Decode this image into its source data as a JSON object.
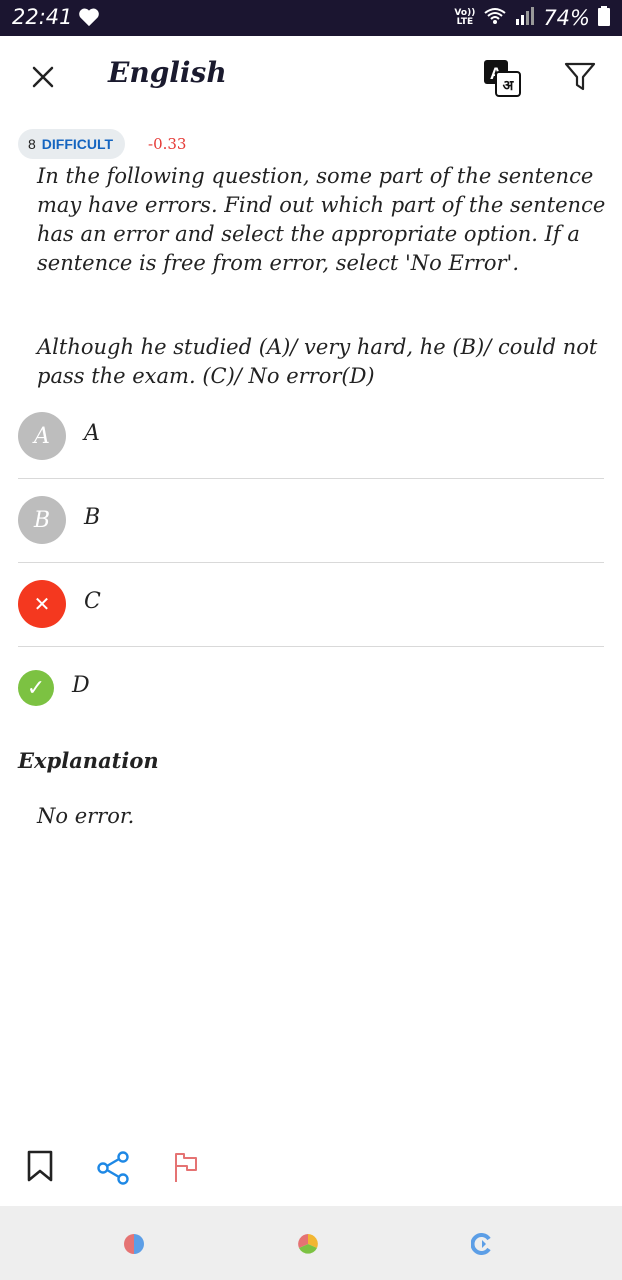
{
  "status_bar": {
    "time": "22:41",
    "network_top": "Vo))",
    "network_bottom": "LTE",
    "battery": "74%"
  },
  "app_bar": {
    "title": "English",
    "close_icon": "close-icon",
    "translate_icon": "translate-icon",
    "filter_icon": "filter-icon"
  },
  "question": {
    "difficulty_level": "8",
    "difficulty_label": "DIFFICULT",
    "score": "-0.33",
    "instruction": "In the following question, some part of the sentence may have errors. Find out which part of the sentence has an error and select the appropriate option. If a sentence is free from error, select 'No Error'.",
    "sentence": " Although he studied (A)/ very hard, he (B)/ could not pass the exam. (C)/ No error(D)"
  },
  "options": [
    {
      "letter": "A",
      "text": "A",
      "state": "neutral",
      "color": "#bdbdbd"
    },
    {
      "letter": "B",
      "text": "B",
      "state": "neutral",
      "color": "#bdbdbd"
    },
    {
      "letter": "✕",
      "text": "C",
      "state": "wrong",
      "color": "#f4381f"
    },
    {
      "letter": "✓",
      "text": "D",
      "state": "correct",
      "color": "#7cc242"
    }
  ],
  "explanation": {
    "heading": "Explanation",
    "text": "No error."
  },
  "actions": {
    "bookmark_icon": "bookmark-icon",
    "share_icon": "share-icon",
    "report_icon": "flag-icon"
  },
  "colors": {
    "status_bar": "#1b1530",
    "accent_blue": "#1565c0",
    "score_red": "#e53935",
    "wrong_red": "#f4381f",
    "correct_green": "#7cc242",
    "share_blue": "#1e88e5",
    "flag_red": "#e57373"
  }
}
